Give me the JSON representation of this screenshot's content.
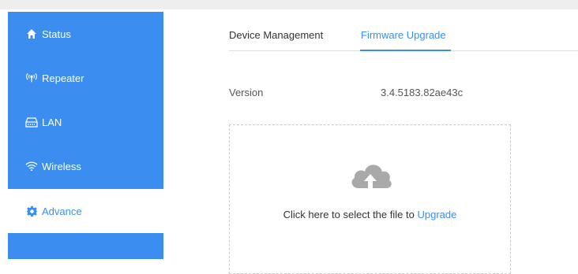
{
  "sidebar": {
    "items": [
      {
        "label": "Status",
        "icon": "home-icon"
      },
      {
        "label": "Repeater",
        "icon": "repeater-icon"
      },
      {
        "label": "LAN",
        "icon": "lan-icon"
      },
      {
        "label": "Wireless",
        "icon": "wifi-icon"
      },
      {
        "label": "Advance",
        "icon": "gear-icon",
        "active": true
      }
    ]
  },
  "tabs": [
    {
      "label": "Device Management"
    },
    {
      "label": "Firmware Upgrade",
      "active": true
    }
  ],
  "version": {
    "label": "Version",
    "value": "3.4.5183.82ae43c"
  },
  "upload": {
    "icon": "cloud-upload-icon",
    "prefix": "Click here to select the file to",
    "link": "Upgrade"
  },
  "colors": {
    "accent": "#3b8ef0",
    "sidebar_bg": "#3b8ef0"
  }
}
